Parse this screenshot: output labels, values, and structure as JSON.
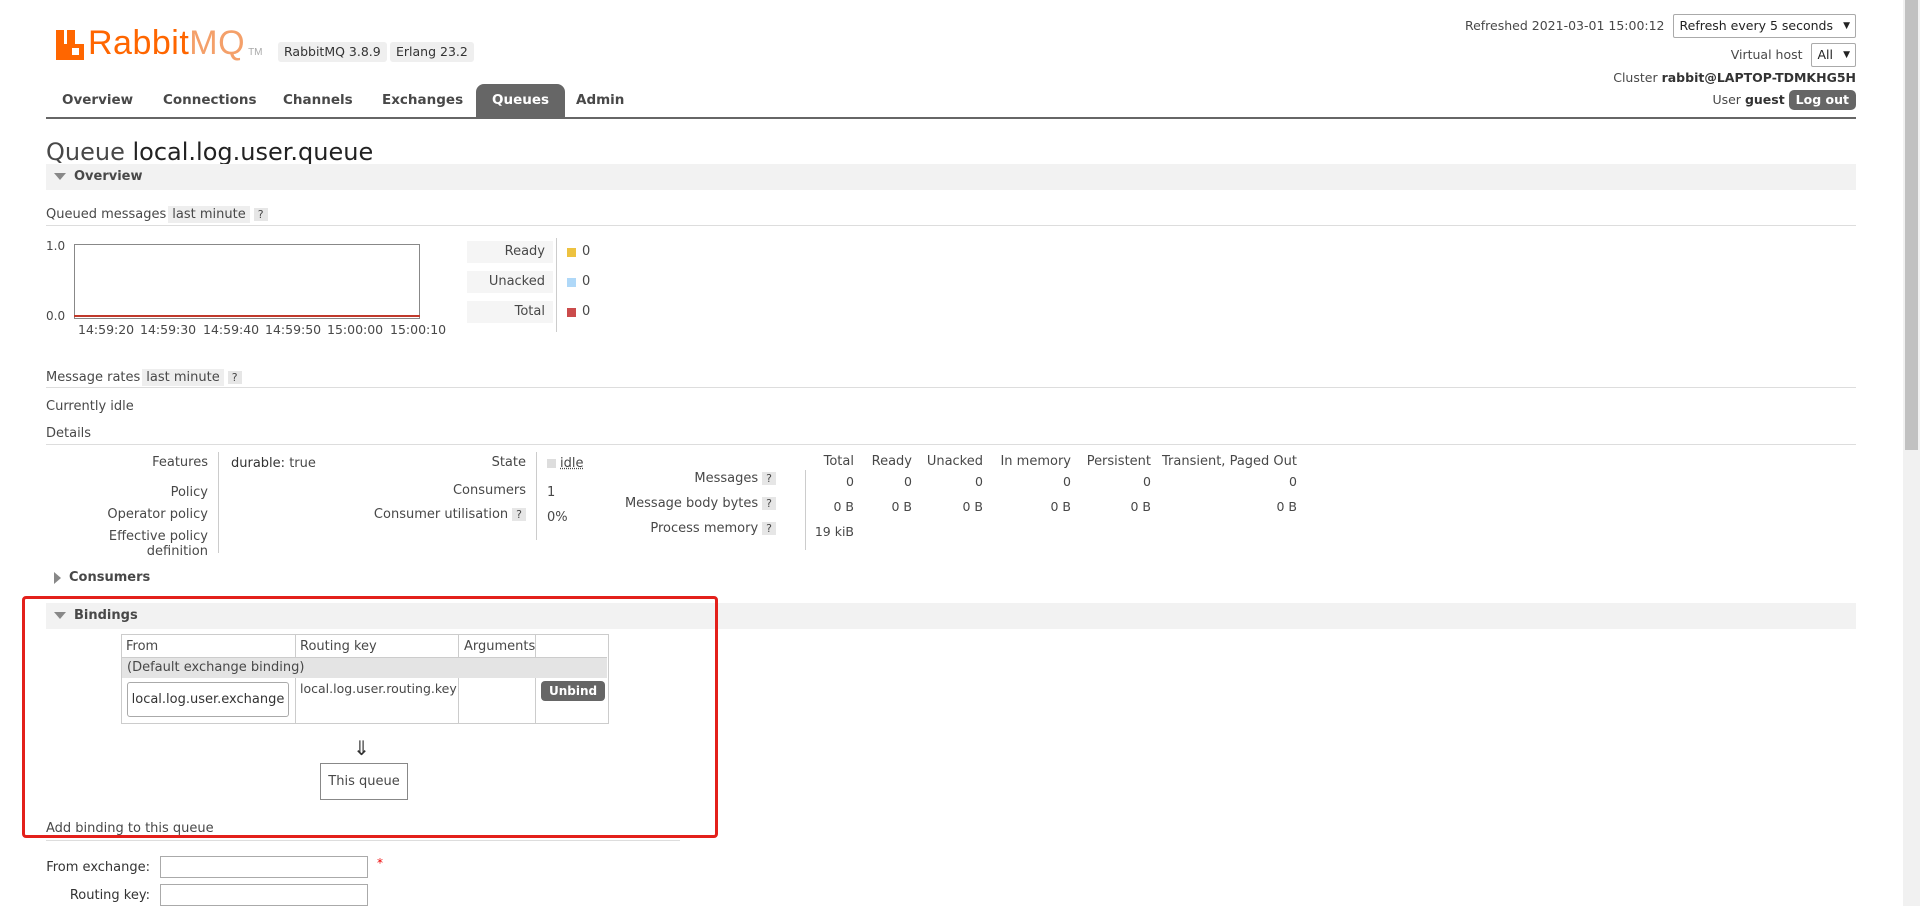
{
  "header": {
    "brand_main": "Rabbit",
    "brand_mq": "MQ",
    "brand_tm": "TM",
    "rabbitmq_version": "RabbitMQ 3.8.9",
    "erlang_version": "Erlang 23.2",
    "refreshed_label": "Refreshed 2021-03-01 15:00:12",
    "refresh_select": "Refresh every 5 seconds",
    "vhost_label": "Virtual host",
    "vhost_select": "All",
    "cluster_label": "Cluster",
    "cluster_name": "rabbit@LAPTOP-TDMKHG5H",
    "user_label": "User",
    "user_name": "guest",
    "logout": "Log out"
  },
  "nav": {
    "tabs": [
      {
        "label": "Overview"
      },
      {
        "label": "Connections"
      },
      {
        "label": "Channels"
      },
      {
        "label": "Exchanges"
      },
      {
        "label": "Queues"
      },
      {
        "label": "Admin"
      }
    ],
    "active": "Queues"
  },
  "page": {
    "title_prefix": "Queue",
    "queue_name": "local.log.user.queue"
  },
  "overview": {
    "section_title": "Overview",
    "queued_messages_label": "Queued messages",
    "range_pill": "last minute",
    "help": "?",
    "chart": {
      "y_top": "1.0",
      "y_bottom": "0.0",
      "x_labels": [
        "14:59:20",
        "14:59:30",
        "14:59:40",
        "14:59:50",
        "15:00:00",
        "15:00:10"
      ]
    },
    "legend": [
      {
        "label": "Ready",
        "value": "0",
        "color": "#edc240"
      },
      {
        "label": "Unacked",
        "value": "0",
        "color": "#afd8f8"
      },
      {
        "label": "Total",
        "value": "0",
        "color": "#cb4b4b"
      }
    ],
    "message_rates_label": "Message rates",
    "message_rates_pill": "last minute",
    "currently_idle": "Currently idle",
    "details_label": "Details"
  },
  "details": {
    "features_label": "Features",
    "durable_key": "durable:",
    "durable_val": "true",
    "policy_label": "Policy",
    "operator_policy_label": "Operator policy",
    "effective_policy_label": "Effective policy definition",
    "state_label": "State",
    "state_val": "idle",
    "consumers_label": "Consumers",
    "consumers_val": "1",
    "utilisation_label": "Consumer utilisation",
    "utilisation_val": "0%",
    "columns": [
      "Total",
      "Ready",
      "Unacked",
      "In memory",
      "Persistent",
      "Transient, Paged Out"
    ],
    "rows": [
      {
        "label": "Messages",
        "values": [
          "0",
          "0",
          "0",
          "0",
          "0",
          "0"
        ]
      },
      {
        "label": "Message body bytes",
        "values": [
          "0 B",
          "0 B",
          "0 B",
          "0 B",
          "0 B",
          "0 B"
        ]
      },
      {
        "label": "Process memory",
        "values": [
          "19 kiB"
        ]
      }
    ]
  },
  "consumers_section": {
    "title": "Consumers"
  },
  "bindings": {
    "title": "Bindings",
    "columns": [
      "From",
      "Routing key",
      "Arguments"
    ],
    "default_binding": "(Default exchange binding)",
    "row": {
      "from": "local.log.user.exchange",
      "routing_key": "local.log.user.routing.key",
      "arguments": ""
    },
    "unbind": "Unbind",
    "arrow": "⇓",
    "this_queue": "This queue"
  },
  "add_binding": {
    "title": "Add binding to this queue",
    "from_exchange_label": "From exchange:",
    "routing_key_label": "Routing key:",
    "required_mark": "*",
    "from_exchange_value": "",
    "routing_key_value": ""
  }
}
